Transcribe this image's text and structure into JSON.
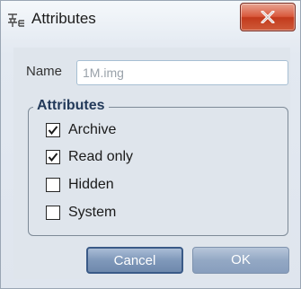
{
  "window": {
    "title": "Attributes"
  },
  "name_field": {
    "label": "Name",
    "value": "1M.img"
  },
  "attributes": {
    "legend": "Attributes",
    "options": [
      {
        "label": "Archive",
        "checked": true
      },
      {
        "label": "Read only",
        "checked": true
      },
      {
        "label": "Hidden",
        "checked": false
      },
      {
        "label": "System",
        "checked": false
      }
    ]
  },
  "buttons": {
    "cancel_label": "Cancel",
    "ok_label": "OK"
  },
  "colors": {
    "close_button": "#d9593c",
    "legend_text": "#233a5a",
    "button_blue": "#7f98ba"
  },
  "icons": {
    "title": "attributes-icon",
    "close": "close-icon",
    "check": "checkmark-icon"
  }
}
